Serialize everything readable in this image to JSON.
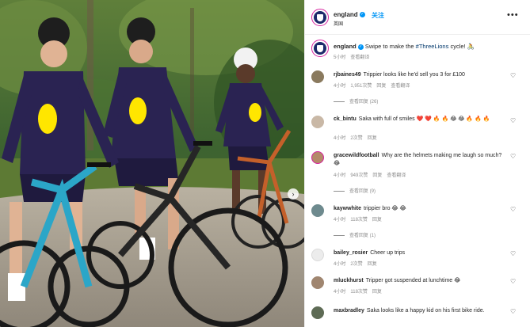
{
  "post": {
    "account": "england",
    "follow_label": "关注",
    "subtitle": "英国",
    "more_label": "•••",
    "caption_user": "england",
    "caption_before": "Swipe to make the ",
    "caption_hashtag": "#ThreeLions",
    "caption_after": " cycle! 🚴",
    "caption_time": "5小时",
    "caption_translate": "查看翻译"
  },
  "photo": {
    "shirt_sponsor": "EE",
    "next_icon": "chevron-right-icon"
  },
  "comments": [
    {
      "user": "rjbaines49",
      "text": "Trippier looks like he'd sell you 3 for £100",
      "time": "4小时",
      "likes": "1,951次赞",
      "reply": "回复",
      "translate": "查看翻译",
      "replies": "查看回复 (26)"
    },
    {
      "user": "ck_bintu",
      "text": "Saka with full of smiles ❤️ ❤️ 🔥 🔥 😂 😂 🔥 🔥 🔥",
      "time": "4小时",
      "likes": "2次赞",
      "reply": "回复",
      "translate": "",
      "replies": ""
    },
    {
      "user": "gracewildfootball",
      "text": "Why are the helmets making me laugh so much? 😂",
      "time": "4小时",
      "likes": "949次赞",
      "reply": "回复",
      "translate": "查看翻译",
      "replies": "查看回复 (9)"
    },
    {
      "user": "kaywwhite",
      "text": "trippier bro 😂 😂",
      "time": "4小时",
      "likes": "118次赞",
      "reply": "回复",
      "translate": "",
      "replies": "查看回复 (1)"
    },
    {
      "user": "bailey_rosier",
      "text": "Cheer up trips",
      "time": "4小时",
      "likes": "2次赞",
      "reply": "回复",
      "translate": "",
      "replies": ""
    },
    {
      "user": "mluckhurst",
      "text": "Tripper got suspended at lunchtime 😂",
      "time": "4小时",
      "likes": "118次赞",
      "reply": "回复",
      "translate": "",
      "replies": ""
    },
    {
      "user": "maxbradley",
      "text": "Saka looks like a happy kid on his first bike ride.",
      "time": "",
      "likes": "",
      "reply": "",
      "translate": "",
      "replies": ""
    }
  ],
  "colors": {
    "accent": "#0095f6",
    "hashtag": "#00376b",
    "muted": "#8e8e8e",
    "shirt": "#2a2352"
  }
}
